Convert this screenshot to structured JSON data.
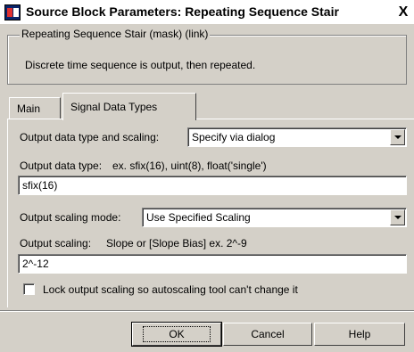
{
  "window": {
    "title": "Source Block Parameters: Repeating Sequence Stair",
    "close_glyph": "X"
  },
  "group": {
    "legend": "Repeating Sequence Stair (mask) (link)",
    "description": "Discrete time sequence is output, then repeated."
  },
  "tabs": [
    {
      "label": "Main",
      "active": false
    },
    {
      "label": "Signal Data Types",
      "active": true
    }
  ],
  "form": {
    "data_type_scaling_label": "Output data type and scaling:",
    "data_type_scaling_value": "Specify via dialog",
    "data_type_label": "Output data type:",
    "data_type_hint": "ex.  sfix(16),  uint(8),  float('single')",
    "data_type_value": "sfix(16)",
    "scaling_mode_label": "Output scaling mode:",
    "scaling_mode_value": "Use Specified Scaling",
    "scaling_label": "Output scaling:",
    "scaling_hint": "Slope or [Slope Bias]   ex.  2^-9",
    "scaling_value": "2^-12",
    "lock_label": "Lock output scaling so autoscaling tool can't change it",
    "lock_checked": false
  },
  "buttons": {
    "ok": "OK",
    "cancel": "Cancel",
    "help": "Help"
  }
}
